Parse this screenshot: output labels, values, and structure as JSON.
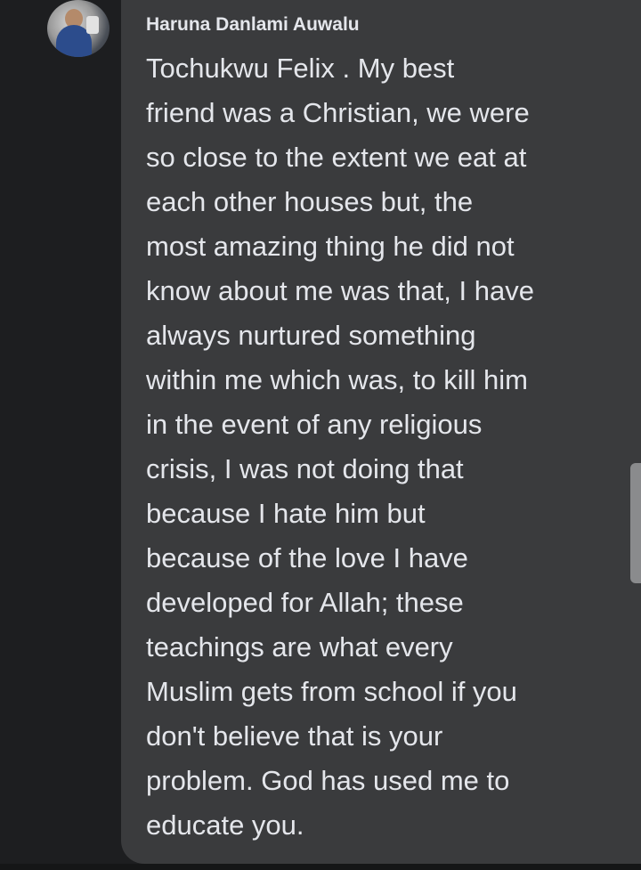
{
  "comment": {
    "author": "Haruna Danlami Auwalu",
    "lines": [
      "Tochukwu Felix . My best",
      "friend was a Christian, we were",
      "so close to the extent we eat at",
      "each other houses but, the",
      "most amazing thing he did not",
      "know about me was that, I have",
      "always nurtured something",
      "within me which was, to kill him",
      "in the event of any religious",
      "crisis, I was not doing that",
      "because I hate him but",
      "because of the love I have",
      "developed for Allah; these",
      "teachings are what every",
      "Muslim gets from school if you",
      "don't believe that is your",
      "problem. God has used me to",
      "educate you."
    ]
  },
  "colors": {
    "background": "#1d1e20",
    "bubble": "#3a3b3d",
    "text": "#e4e6eb"
  }
}
